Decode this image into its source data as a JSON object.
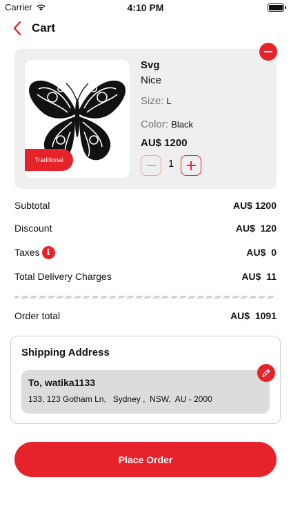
{
  "status_bar": {
    "carrier": "Carrier",
    "time": "4:10 PM"
  },
  "header": {
    "title": "Cart"
  },
  "cart_item": {
    "name": "Svg",
    "description": "Nice",
    "size_label": "Size:",
    "size_value": "L",
    "color_label": "Color:",
    "color_value": "Black",
    "price": "AU$ 1200",
    "quantity": "1",
    "category_tag": "Traditional"
  },
  "summary": {
    "subtotal_label": "Subtotal",
    "subtotal_value": "AU$ 1200",
    "discount_label": "Discount",
    "discount_value": "AU$  120",
    "taxes_label": "Taxes",
    "taxes_value": "AU$  0",
    "delivery_label": "Total Delivery Charges",
    "delivery_value": "AU$  11",
    "order_total_label": "Order total",
    "order_total_value": "AU$  1091"
  },
  "shipping": {
    "title": "Shipping Address",
    "recipient": "To, watika1133",
    "address": "133, 123 Gotham Ln,   Sydney ,  NSW,  AU - 2000"
  },
  "actions": {
    "place_order": "Place Order"
  },
  "colors": {
    "accent": "#e6222a",
    "card_bg": "#efefef",
    "address_bg": "#dcdcdc"
  },
  "icons": [
    "wifi-icon",
    "battery-icon",
    "back-chevron-icon",
    "remove-icon",
    "minus-icon",
    "plus-icon",
    "info-icon",
    "edit-pencil-icon"
  ]
}
